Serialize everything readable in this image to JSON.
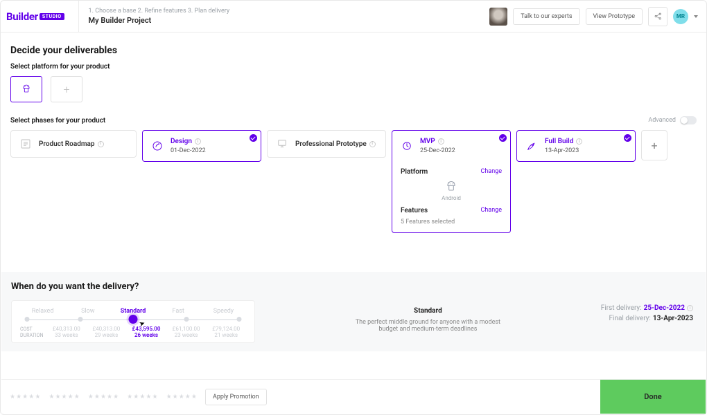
{
  "header": {
    "logo_text": "Builder",
    "logo_badge": "STUDIO",
    "steps": "1. Choose a base   2. Refine features   3. Plan delivery",
    "project_name": "My Builder Project",
    "talk_to_experts": "Talk to our experts",
    "view_prototype": "View Prototype",
    "user_initials": "MR"
  },
  "deliverables": {
    "title": "Decide your deliverables",
    "platform_label": "Select platform for your product",
    "phases_label": "Select phases for your product",
    "advanced_label": "Advanced"
  },
  "phases": [
    {
      "name": "Product Roadmap",
      "date": "",
      "selected": false,
      "icon": "roadmap"
    },
    {
      "name": "Design",
      "date": "01-Dec-2022",
      "selected": true,
      "icon": "design"
    },
    {
      "name": "Professional Prototype",
      "date": "",
      "selected": false,
      "icon": "prototype"
    },
    {
      "name": "MVP",
      "date": "25-Dec-2022",
      "selected": true,
      "icon": "mvp"
    },
    {
      "name": "Full Build",
      "date": "13-Apr-2023",
      "selected": true,
      "icon": "fullbuild"
    }
  ],
  "mvp_expanded": {
    "platform_label": "Platform",
    "change_label": "Change",
    "platform_name": "Android",
    "features_label": "Features",
    "features_summary": "5 Features selected"
  },
  "delivery": {
    "title": "When do you want the delivery?",
    "speeds": [
      "Relaxed",
      "Slow",
      "Standard",
      "Fast",
      "Speedy"
    ],
    "selected_index": 2,
    "cost_label": "COST",
    "duration_label": "DURATION",
    "costs": [
      "£40,313.00",
      "£40,313.00",
      "£43,595.00",
      "£61,100.00",
      "£79,124.00"
    ],
    "durations": [
      "33 weeks",
      "29 weeks",
      "26 weeks",
      "23 weeks",
      "21 weeks"
    ],
    "plan_name": "Standard",
    "plan_desc": "The perfect middle ground for anyone with a modest budget and medium-term deadlines",
    "first_label": "First delivery:",
    "first_date": "25-Dec-2022",
    "final_label": "Final delivery:",
    "final_date": "13-Apr-2023"
  },
  "footer": {
    "apply_promotion": "Apply Promotion",
    "done": "Done"
  }
}
